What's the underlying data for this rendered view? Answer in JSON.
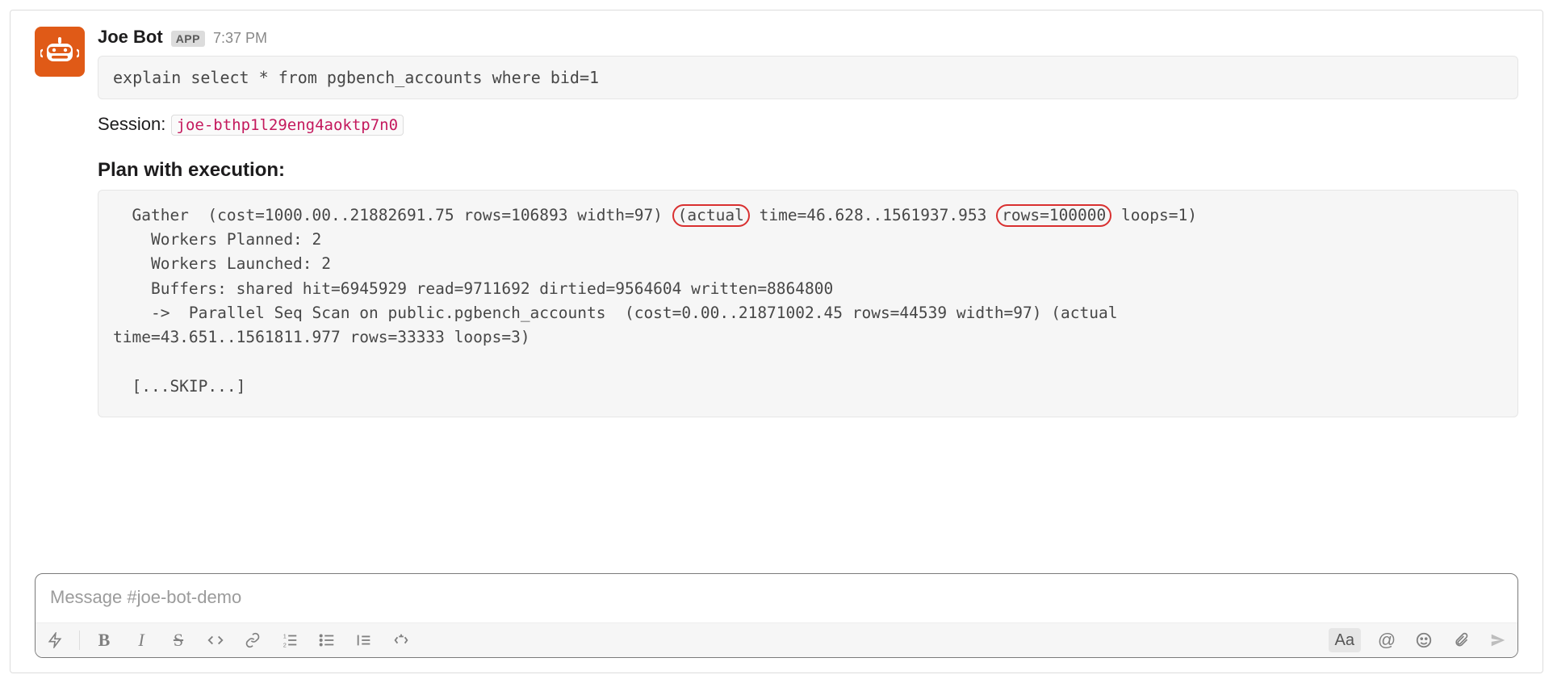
{
  "message": {
    "author": "Joe Bot",
    "app_badge": "APP",
    "timestamp": "7:37 PM",
    "query": "explain select * from pgbench_accounts where bid=1",
    "session_label": "Session:",
    "session_id": "joe-bthp1l29eng4aoktp7n0",
    "plan_title": "Plan with execution:",
    "plan": {
      "l1a": "  Gather  (cost=1000.00..21882691.75 rows=106893 width=97) ",
      "l1_hl1": "(actual",
      "l1b": "time=46.628..1561937.953",
      "l1_hl2": "rows=100000",
      "l1c": "loops=1)",
      "l2": "    Workers Planned: 2",
      "l3": "    Workers Launched: 2",
      "l4": "    Buffers: shared hit=6945929 read=9711692 dirtied=9564604 written=8864800",
      "l5": "    ->  Parallel Seq Scan on public.pgbench_accounts  (cost=0.00..21871002.45 rows=44539 width=97) (actual",
      "l6": "time=43.651..1561811.977 rows=33333 loops=3)",
      "skip": "  [...SKIP...]"
    }
  },
  "composer": {
    "placeholder": "Message #joe-bot-demo",
    "icons": {
      "bolt": "bolt-icon",
      "bold": "B",
      "italic": "I",
      "strike": "S",
      "code": "code-icon",
      "link": "link-icon",
      "olist": "ordered-list-icon",
      "ulist": "bullet-list-icon",
      "quote": "quote-icon",
      "codeblock": "code-block-icon",
      "aa": "Aa",
      "mention": "@",
      "emoji": "emoji-icon",
      "attach": "attach-icon",
      "send": "send-icon"
    }
  }
}
